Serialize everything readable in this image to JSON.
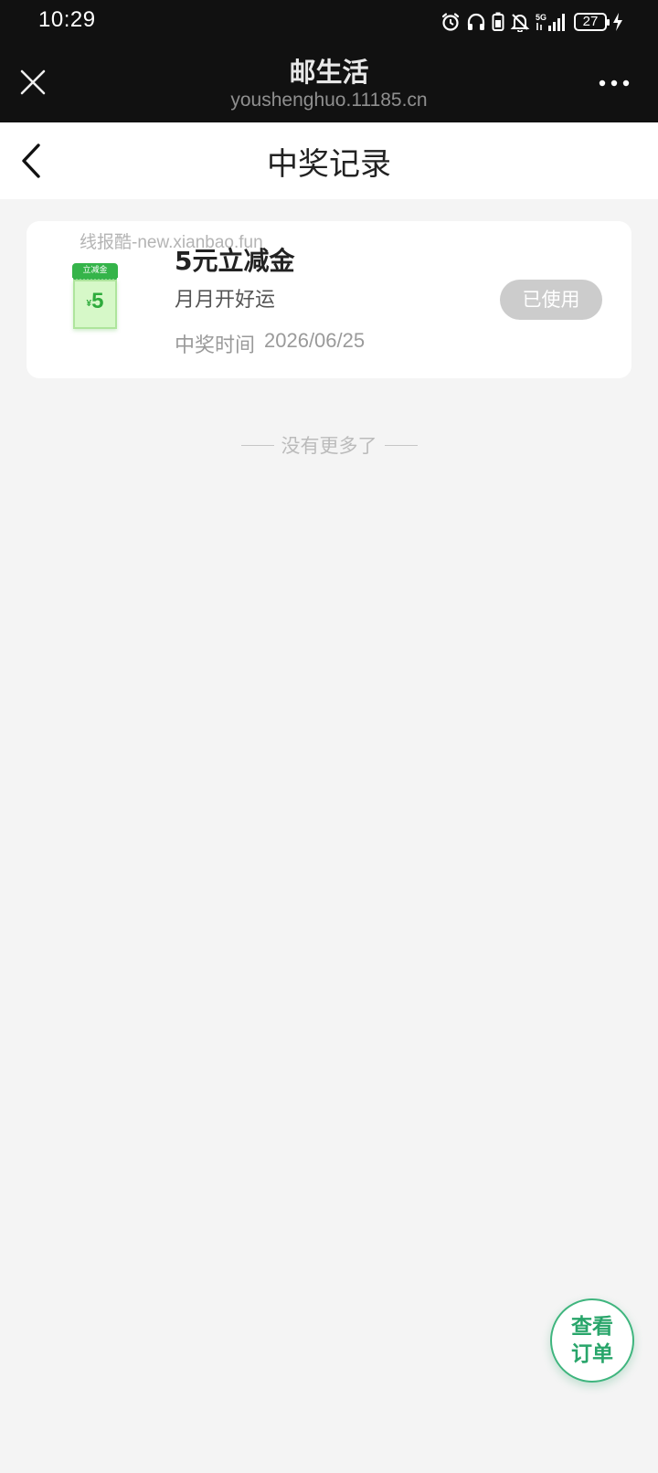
{
  "status_bar": {
    "time": "10:29",
    "network": "5G",
    "battery": "27",
    "icons": [
      "alarm-icon",
      "headphones-icon",
      "battery-saver-icon",
      "mute-bell-icon",
      "signal-icon",
      "charging-icon"
    ]
  },
  "miniprogram": {
    "title": "邮生活",
    "domain": "youshenghuo.11185.cn",
    "icons": [
      "close-icon",
      "more-icon"
    ]
  },
  "nav": {
    "title": "中奖记录",
    "icons": [
      "back-arrow-icon"
    ]
  },
  "record": {
    "watermark": "线报酷-new.xianbao.fun",
    "coupon_tag": "立减金",
    "coupon_currency": "¥",
    "coupon_amount": "5",
    "name": "5元立减金",
    "desc": "月月开好运",
    "time_label": "中奖时间",
    "time_value": "2026/06/25",
    "status": "已使用"
  },
  "list_end": "没有更多了",
  "float_button": {
    "line1": "查看",
    "line2": "订单"
  },
  "colors": {
    "dark_header": "#111111",
    "page_bg": "#f4f4f4",
    "accent_green": "#28a56a",
    "coupon_green": "#35b44a",
    "used_gray": "#cccccc"
  }
}
